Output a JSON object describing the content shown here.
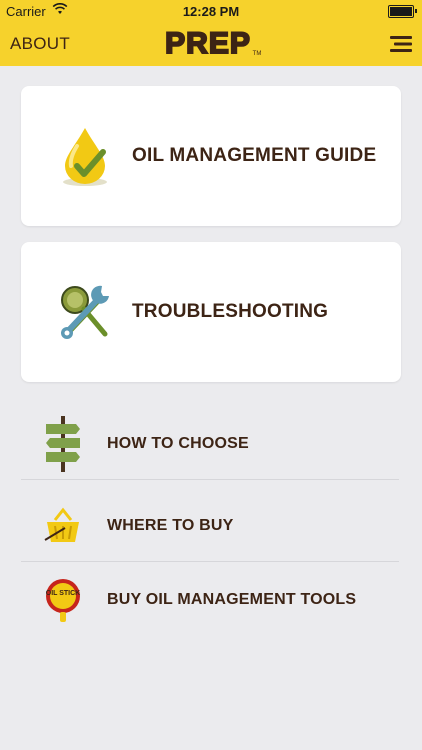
{
  "status_bar": {
    "carrier": "Carrier",
    "time": "12:28 PM"
  },
  "header": {
    "about_label": "ABOUT",
    "logo_text": "PREP",
    "logo_tm": "TM",
    "menu_icon": "hamburger-icon"
  },
  "cards": [
    {
      "label": "OIL MANAGEMENT GUIDE",
      "icon": "oil-drop-check-icon"
    },
    {
      "label": "TROUBLESHOOTING",
      "icon": "wrench-magnifier-icon"
    }
  ],
  "list": [
    {
      "label": "HOW TO CHOOSE",
      "icon": "signpost-icon"
    },
    {
      "label": "WHERE TO BUY",
      "icon": "basket-icon"
    },
    {
      "label": "BUY OIL MANAGEMENT TOOLS",
      "icon": "oil-stick-icon"
    }
  ],
  "logo_badge_text": "OIL STICK",
  "colors": {
    "header_bg": "#f6d22c",
    "text_brown": "#3d2415",
    "page_bg": "#ebebee"
  }
}
